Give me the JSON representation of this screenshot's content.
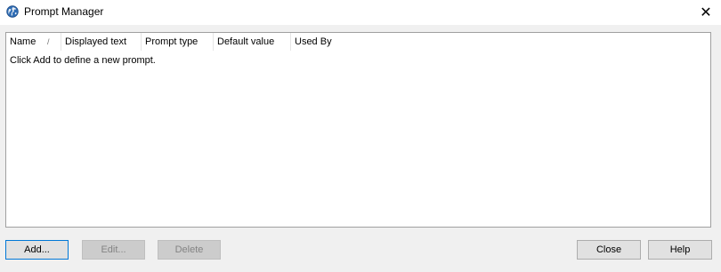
{
  "window": {
    "title": "Prompt Manager",
    "app_icon": "globe-icon",
    "close_icon": "close-icon",
    "close_glyph": "✕"
  },
  "list": {
    "columns": [
      {
        "label": "Name"
      },
      {
        "label": "Displayed text"
      },
      {
        "label": "Prompt type"
      },
      {
        "label": "Default value"
      },
      {
        "label": "Used By"
      }
    ],
    "sort_indicator": "/",
    "empty_message": "Click Add to define a new prompt."
  },
  "buttons": {
    "add": "Add...",
    "edit": "Edit...",
    "delete": "Delete",
    "close": "Close",
    "help": "Help"
  }
}
